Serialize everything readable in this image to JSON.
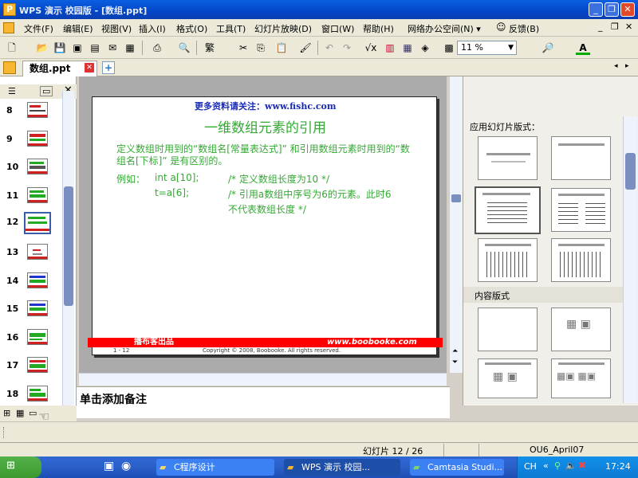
{
  "window": {
    "title": "WPS 演示 校园版 - [数组.ppt]",
    "app_icon": "P"
  },
  "menubar": {
    "items": [
      "文件(F)",
      "编辑(E)",
      "视图(V)",
      "插入(I)",
      "格式(O)",
      "工具(T)",
      "幻灯片放映(D)",
      "窗口(W)",
      "帮助(H)",
      "网络办公空间(N) ▾",
      "反馈(B)"
    ]
  },
  "toolbar": {
    "zoom": "11 %"
  },
  "doc_tab": {
    "label": "数组.ppt"
  },
  "thumbnails": [
    {
      "num": "8"
    },
    {
      "num": "9"
    },
    {
      "num": "10"
    },
    {
      "num": "11"
    },
    {
      "num": "12",
      "selected": true
    },
    {
      "num": "13"
    },
    {
      "num": "14"
    },
    {
      "num": "15"
    },
    {
      "num": "16"
    },
    {
      "num": "17"
    },
    {
      "num": "18"
    }
  ],
  "slide": {
    "header": "更多资料请关注：www.fishc.com",
    "title": "一维数组元素的引用",
    "para1": "定义数组时用到的“数组名[常量表达式]” 和引用数组元素时用到的“数组名[下标]” 是有区别的。",
    "example_label": "例如：",
    "example_code1": "int a[10];",
    "example_comment1": "/* 定义数组长度为10 */",
    "example_code2": "t=a[6];",
    "example_comment2": "/* 引用a数组中序号为6的元素。此时6不代表数组长度 */",
    "footer_brand": "播布客出品",
    "footer_url": "www.boobooke.com",
    "footer_page": "1 - 12",
    "footer_copyright": "Copyright © 2008, Boobooke. All rights reserved."
  },
  "notes": {
    "placeholder": "单击添加备注"
  },
  "taskpane": {
    "section1": "应用幻灯片版式：",
    "section2": "内容版式"
  },
  "statusbar": {
    "slide_info": "幻灯片 12 / 26",
    "template": "OU6_April07"
  },
  "taskbar": {
    "items": [
      "C程序设计",
      "WPS 演示 校园...",
      "Camtasia Studi..."
    ],
    "lang": "CH",
    "clock": "17:24"
  },
  "colors": {
    "accent": "#0a5fe0",
    "slide_green": "#33aa33",
    "slide_blue": "#1a2bb8",
    "footer_red": "#ff0000"
  }
}
